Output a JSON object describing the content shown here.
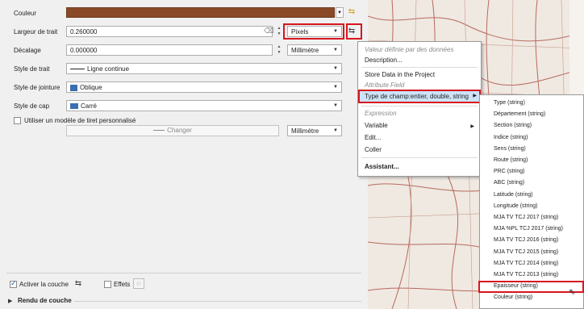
{
  "form": {
    "color_label": "Couleur",
    "color_value": "#8b4a27",
    "stroke_width_label": "Largeur de trait",
    "stroke_width_value": "0.260000",
    "stroke_unit": "Pixels",
    "offset_label": "Décalage",
    "offset_value": "0.000000",
    "offset_unit": "Millimètre",
    "stroke_style_label": "Style de trait",
    "stroke_style_value": "Ligne continue",
    "join_style_label": "Style de jointure",
    "join_style_value": "Oblique",
    "cap_style_label": "Style de cap",
    "cap_style_value": "Carré",
    "custom_dash_label": "Utiliser un modèle de tiret personnalisé",
    "change_button": "Changer",
    "dash_unit": "Millimètre",
    "activate_layer_label": "Activer la couche",
    "effects_label": "Effets",
    "layer_rendering_label": "Rendu de couche"
  },
  "context_menu": {
    "header": "Valeur définie par des données",
    "description": "Description...",
    "store_data": "Store Data in the Project",
    "attribute_field": "Attribute Field",
    "field_type": "Type de champ:entier, double, string",
    "expression": "Expression",
    "variable": "Variable",
    "edit": "Edit...",
    "paste": "Coller",
    "assistant": "Assistant..."
  },
  "submenu": {
    "items": [
      "Type  (string)",
      "Département  (string)",
      "Section  (string)",
      "Indice  (string)",
      "Sens  (string)",
      "Route  (string)",
      "PRC  (string)",
      "ABC  (string)",
      "Latitude  (string)",
      "Longitude  (string)",
      "MJA TV TCJ 2017  (string)",
      "MJA %PL TCJ 2017  (string)",
      "MJA TV TCJ 2016  (string)",
      "MJA TV TCJ 2015  (string)",
      "MJA TV TCJ 2014  (string)",
      "MJA TV TCJ 2013  (string)",
      "Epaisseur  (string)",
      "Couleur  (string)"
    ]
  },
  "colors": {
    "highlight": "#d6171e",
    "menu_selected": "#3b8ad9"
  }
}
